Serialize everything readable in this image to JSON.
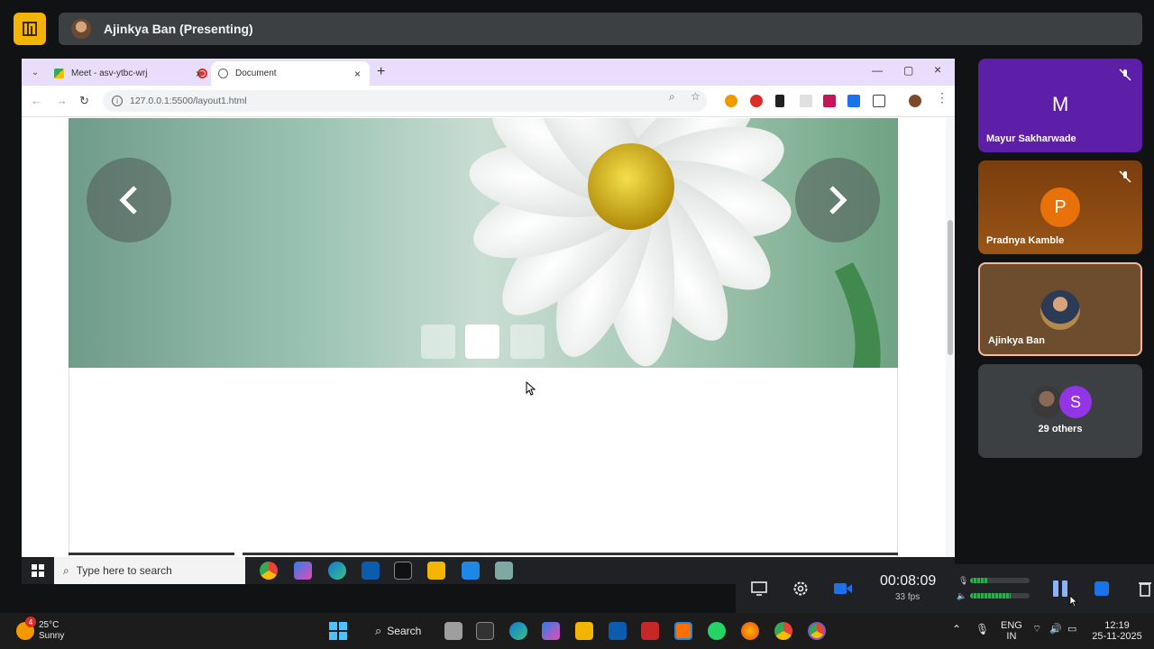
{
  "meet": {
    "presenter_label": "Ajinkya Ban (Presenting)",
    "participants": [
      {
        "name": "Mayur Sakharwade",
        "initial": "M",
        "muted": true,
        "color": "#5e1fa8"
      },
      {
        "name": "Pradnya Kamble",
        "initial": "P",
        "muted": true,
        "color": "#8c4a12"
      },
      {
        "name": "Ajinkya Ban",
        "muted": false,
        "active": true
      },
      {
        "name": "29 others",
        "initial": "S"
      }
    ]
  },
  "browser": {
    "tabs": [
      {
        "title": "Meet - asv-ytbc-wrj",
        "close": "×"
      },
      {
        "title": "Document",
        "close": "×"
      }
    ],
    "new_tab": "+",
    "url": "127.0.0.1:5500/layout1.html",
    "window_controls": {
      "minimize": "—",
      "maximize": "▢",
      "close": "×"
    }
  },
  "slider": {
    "active_dot_index": 1,
    "dot_count": 3
  },
  "inner_taskbar": {
    "search_placeholder": "Type here to search"
  },
  "recorder": {
    "elapsed": "00:08:09",
    "fps": "33 fps"
  },
  "host_taskbar": {
    "weather_temp": "25°C",
    "weather_cond": "Sunny",
    "weather_badge": "4",
    "search_label": "Search",
    "language": "ENG",
    "region": "IN",
    "time": "12:19",
    "date": "25-11-2025"
  },
  "colors": {
    "meet_logo": "#f2b400",
    "tabstrip": "#e8defc",
    "active_tile_border": "#f6b99a",
    "meter": "#34a853"
  }
}
